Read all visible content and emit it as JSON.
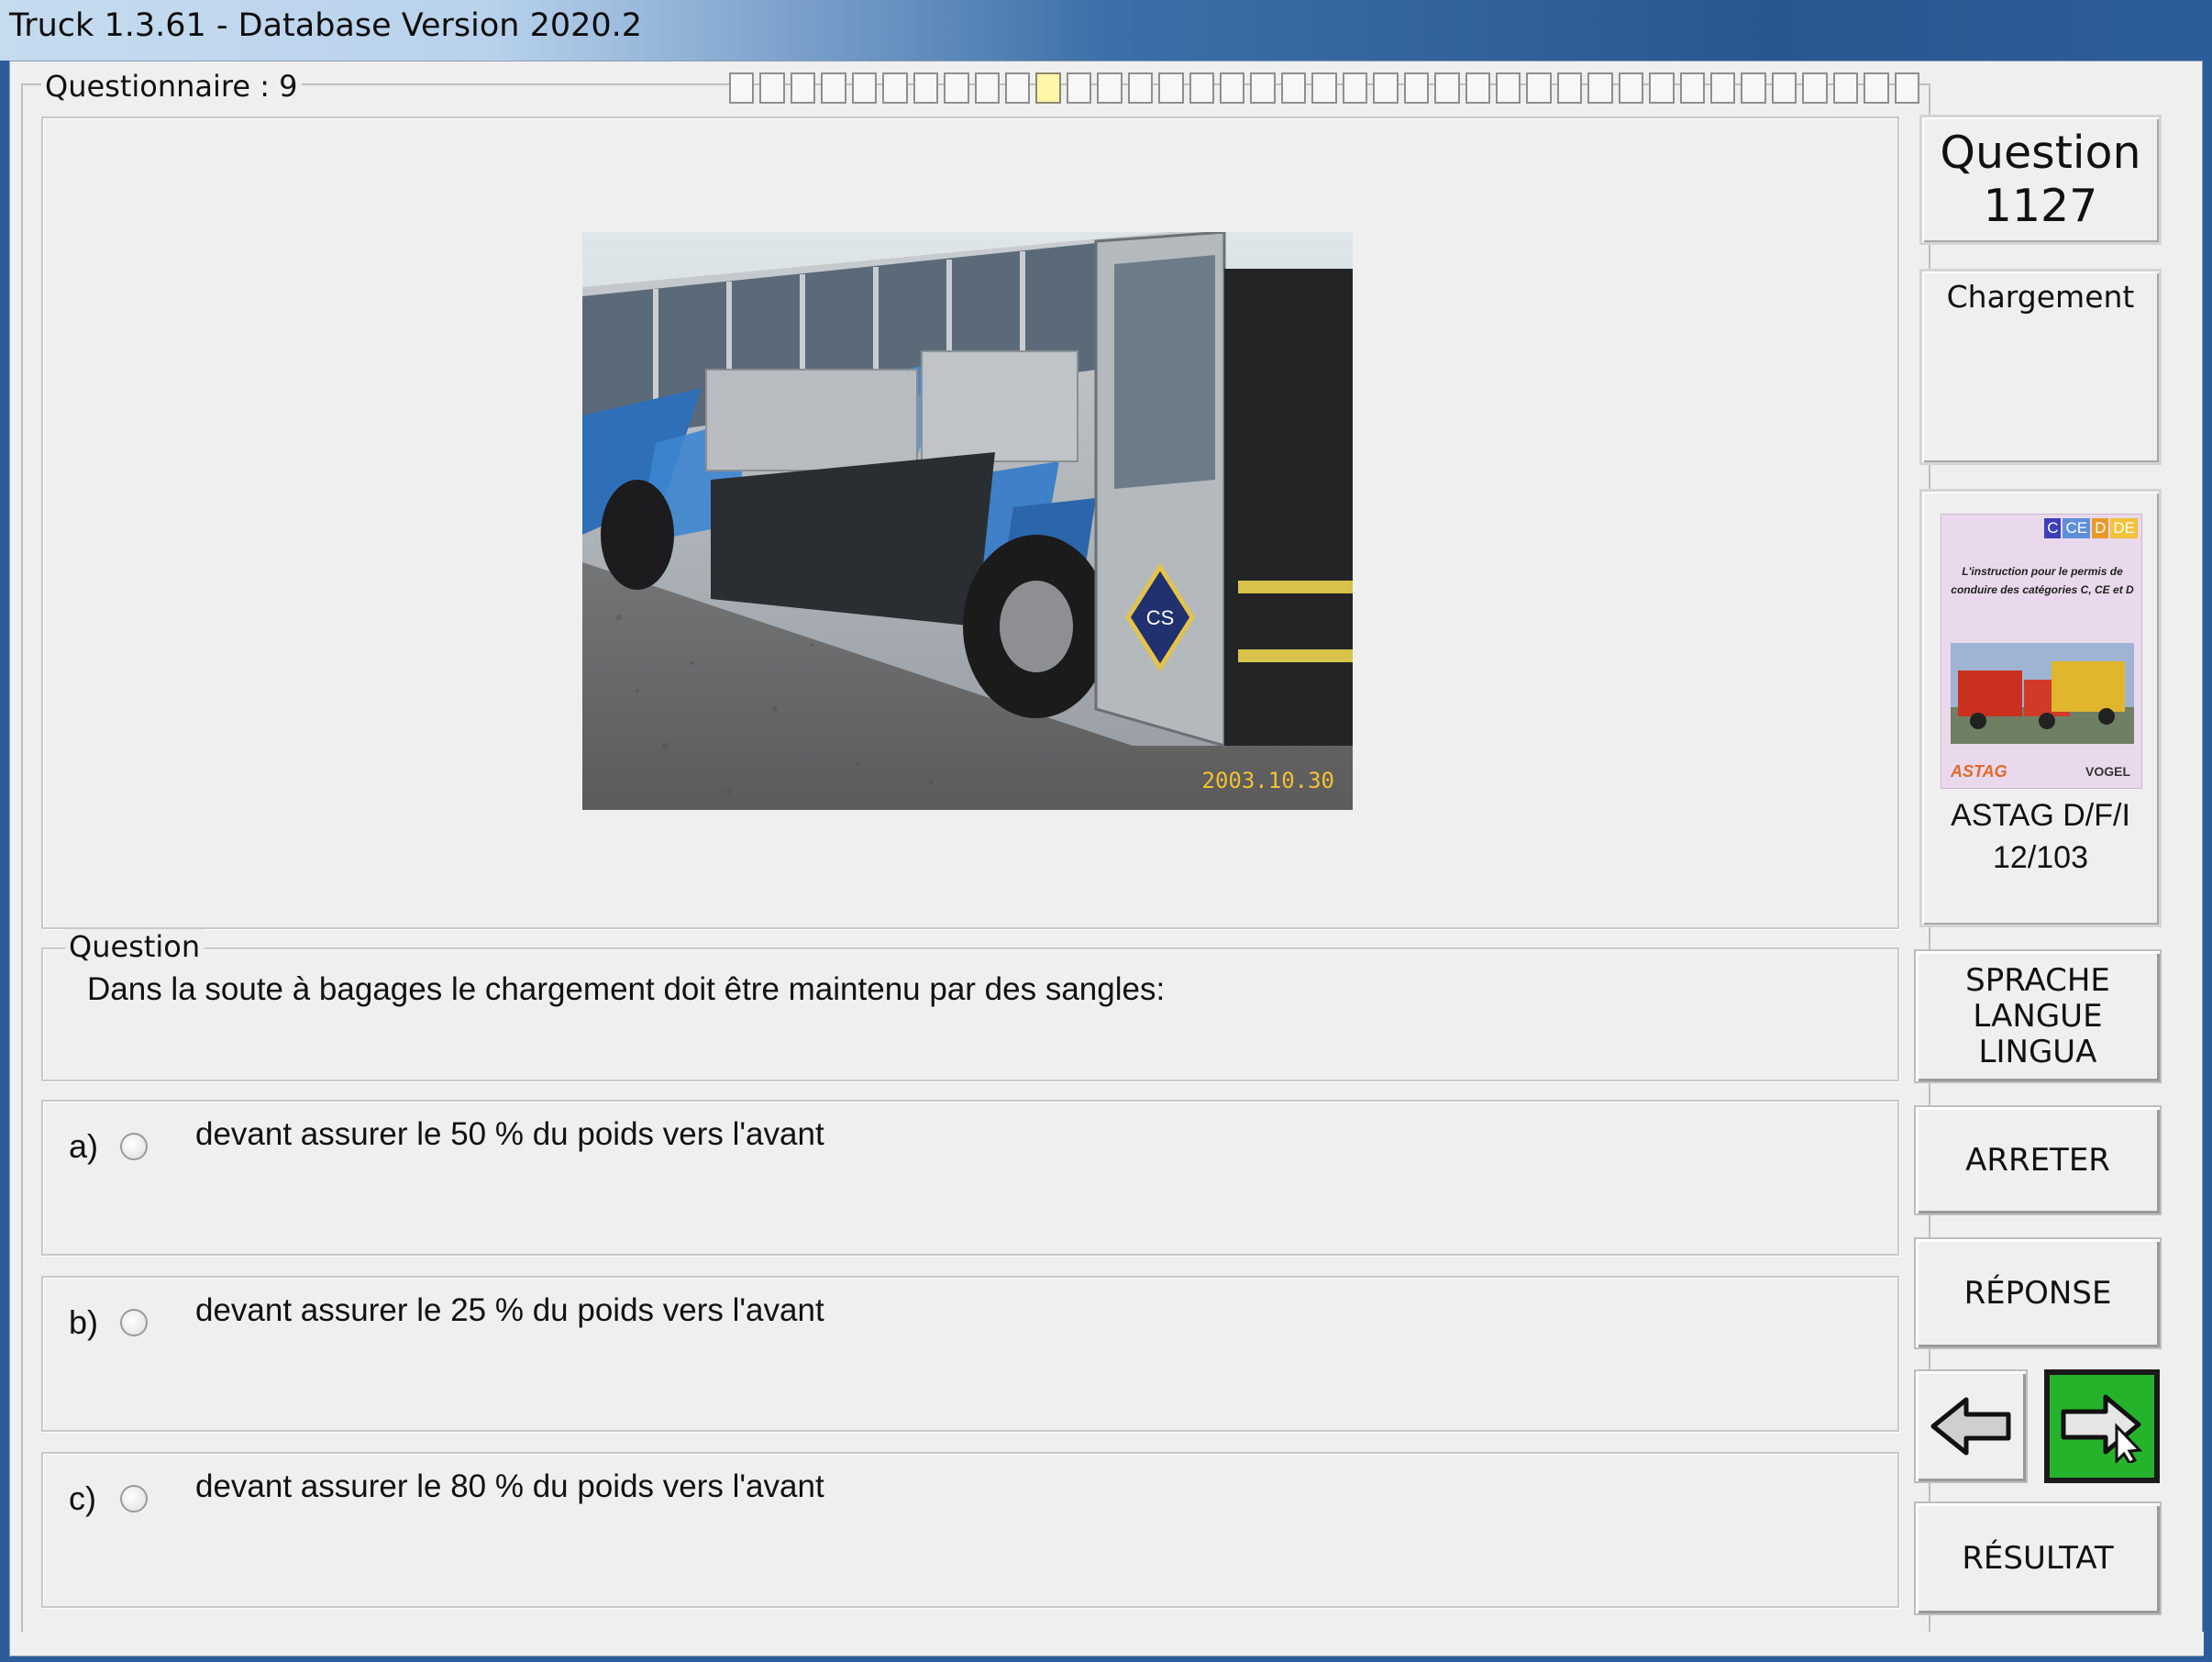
{
  "window": {
    "title": "Truck 1.3.61 - Database Version 2020.2"
  },
  "questionnaire": {
    "label": "Questionnaire : 9",
    "progress_total": 39,
    "progress_current": 11
  },
  "image": {
    "timestamp": "2003.10.30",
    "badge_text": "CS"
  },
  "question": {
    "group_label": "Question",
    "text": "Dans la soute à bagages le chargement doit être maintenu par des sangles:"
  },
  "answers": [
    {
      "letter": "a)",
      "text": "devant assurer le 50 % du poids vers l'avant",
      "selected": false
    },
    {
      "letter": "b)",
      "text": "devant assurer le 25 % du poids vers l'avant",
      "selected": false
    },
    {
      "letter": "c)",
      "text": "devant assurer le 80 % du poids vers l'avant",
      "selected": false
    }
  ],
  "sidebar": {
    "question_label": "Question",
    "question_number": "1127",
    "category": "Chargement",
    "book": {
      "cover_tags": [
        "C",
        "CE",
        "D",
        "DE"
      ],
      "cover_text": "L'instruction pour le permis de conduire des catégories C, CE et D",
      "cover_left_logo": "ASTAG",
      "cover_right_logo": "VOGEL",
      "source": "ASTAG D/F/I",
      "reference": "12/103"
    },
    "language_button": "SPRACHE\nLANGUE\nLINGUA",
    "stop_button": "ARRETER",
    "answer_button": "RÉPONSE",
    "result_button": "RÉSULTAT"
  }
}
